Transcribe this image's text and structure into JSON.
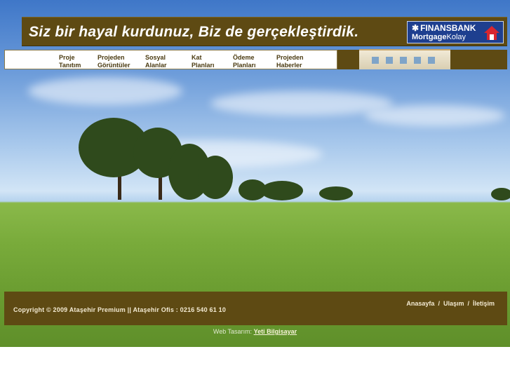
{
  "header": {
    "slogan": "Siz bir hayal kurdunuz, Biz de gerçekleştirdik.",
    "bank_name": "FINANSBANK",
    "bank_product_bold": "Mortgage",
    "bank_product_light": "Kolay"
  },
  "nav": {
    "items": [
      {
        "line1": "Proje",
        "line2": "Tanıtım"
      },
      {
        "line1": "Projeden",
        "line2": "Görüntüler"
      },
      {
        "line1": "Sosyal",
        "line2": "Alanlar"
      },
      {
        "line1": "Kat",
        "line2": "Planları"
      },
      {
        "line1": "Ödeme",
        "line2": "Planları"
      },
      {
        "line1": "Projeden",
        "line2": "Haberler"
      }
    ]
  },
  "footer": {
    "copyright": "Copyright © 2009 Ataşehir Premium || Ataşehir Ofis : 0216 540 61 10",
    "links": [
      "Anasayfa",
      "Ulaşım",
      "İletişim"
    ],
    "separator": "/"
  },
  "credit": {
    "prefix": "Web Tasarım:",
    "link": "Yeti Bilgisayar"
  },
  "colors": {
    "bar_brown": "#5e4a13",
    "bank_blue": "#1e3f8f"
  }
}
